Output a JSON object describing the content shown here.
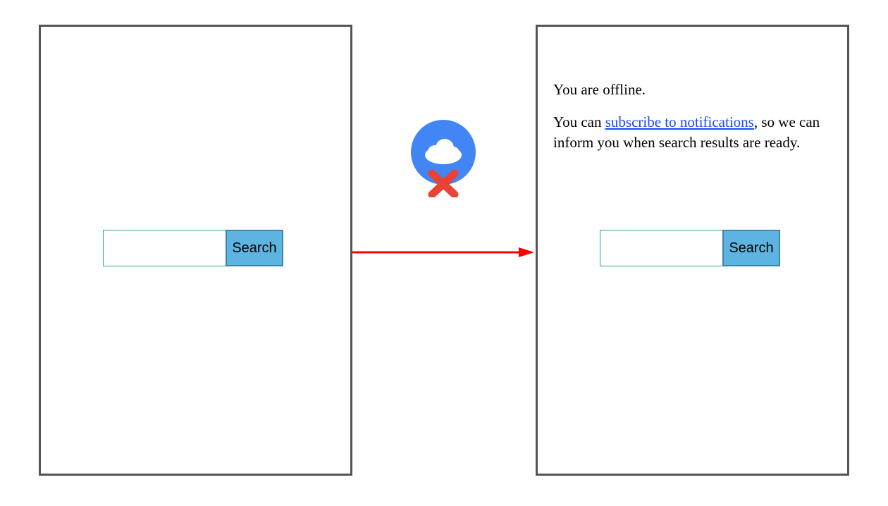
{
  "left": {
    "search_button": "Search",
    "search_value": ""
  },
  "right": {
    "search_button": "Search",
    "search_value": "",
    "offline_line1": "You are offline.",
    "offline_line2_a": "You can ",
    "offline_link": "subscribe to notifications",
    "offline_line2_b": ", so we can inform you when search results are ready."
  },
  "colors": {
    "panel_border": "#555555",
    "input_border": "#2aa6a0",
    "button_fill": "#5eb4e0",
    "button_border": "#3b86ad",
    "arrow": "#ff0000",
    "cloud_bg": "#4285f4",
    "cloud_fg": "#ffffff",
    "cross": "#e94335",
    "link": "#1947ff"
  }
}
